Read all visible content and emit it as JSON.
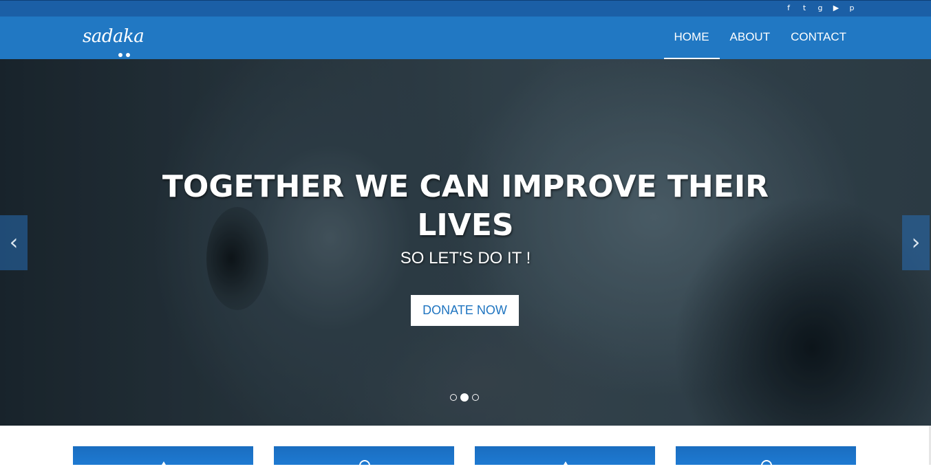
{
  "social": {
    "icons": [
      {
        "name": "facebook-icon",
        "glyph": "f"
      },
      {
        "name": "twitter-icon",
        "glyph": "t"
      },
      {
        "name": "google-plus-icon",
        "glyph": "g"
      },
      {
        "name": "youtube-icon",
        "glyph": "▶"
      },
      {
        "name": "pinterest-icon",
        "glyph": "p"
      }
    ]
  },
  "brand": {
    "logo_text": "sadaka"
  },
  "nav": {
    "home": "HOME",
    "about": "ABOUT",
    "contact": "CONTACT",
    "active": "HOME"
  },
  "hero": {
    "headline_line1": "TOGETHER WE CAN IMPROVE THEIR",
    "headline_line2": "LIVES",
    "subheadline": "SO LET'S DO IT !",
    "cta_label": "DONATE NOW",
    "prev_arrow": "‹",
    "next_arrow": "›",
    "slides_total": 3,
    "active_slide": 2
  },
  "colors": {
    "topbar": "#1b5fa6",
    "navbar": "#2178c3",
    "accent": "#1e74c0",
    "card": "#1e7ad2"
  },
  "feature_cards": [
    {
      "icon": "arrow-up-icon"
    },
    {
      "icon": "circle-icon"
    },
    {
      "icon": "arrow-up-icon"
    },
    {
      "icon": "circle-icon"
    }
  ]
}
